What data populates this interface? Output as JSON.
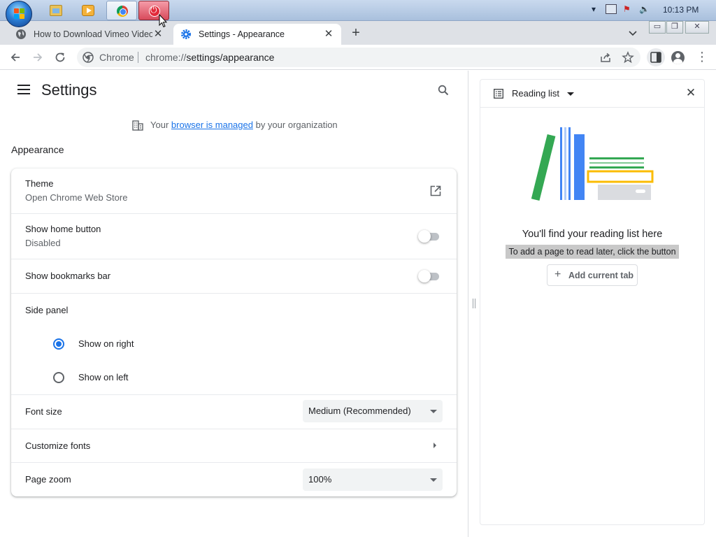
{
  "taskbar": {
    "clock": "10:13 PM",
    "apps": [
      "file-explorer-icon",
      "media-player-icon",
      "chrome-icon",
      "power-app-icon"
    ]
  },
  "tabs": [
    {
      "title": "How to Download Vimeo Videos",
      "active": false,
      "icon": "globe-icon"
    },
    {
      "title": "Settings - Appearance",
      "active": true,
      "icon": "gear-icon"
    }
  ],
  "window_controls": {
    "minimize": "▭",
    "restore": "❐",
    "close": "✕"
  },
  "omnibox": {
    "site_label": "Chrome",
    "url_host": "chrome://",
    "url_path": "settings/appearance"
  },
  "settings": {
    "title": "Settings",
    "managed": {
      "prefix": "Your",
      "link": "browser is managed",
      "suffix": "by your organization"
    },
    "section": "Appearance",
    "rows": {
      "theme": {
        "label": "Theme",
        "sub": "Open Chrome Web Store"
      },
      "home_button": {
        "label": "Show home button",
        "sub": "Disabled",
        "enabled": false
      },
      "bookmarks_bar": {
        "label": "Show bookmarks bar",
        "enabled": false
      },
      "side_panel": {
        "label": "Side panel",
        "options": [
          {
            "label": "Show on right",
            "checked": true
          },
          {
            "label": "Show on left",
            "checked": false
          }
        ]
      },
      "font_size": {
        "label": "Font size",
        "value": "Medium (Recommended)"
      },
      "customize_fonts": {
        "label": "Customize fonts"
      },
      "page_zoom": {
        "label": "Page zoom",
        "value": "100%"
      }
    }
  },
  "side_panel": {
    "title": "Reading list",
    "empty_title": "You'll find your reading list here",
    "empty_sub": "To add a page to read later, click the button",
    "add_button": "Add current tab",
    "colors": {
      "green": "#34a853",
      "blue": "#4285f4",
      "yellow": "#fbbc04",
      "grey": "#dadce0"
    }
  }
}
